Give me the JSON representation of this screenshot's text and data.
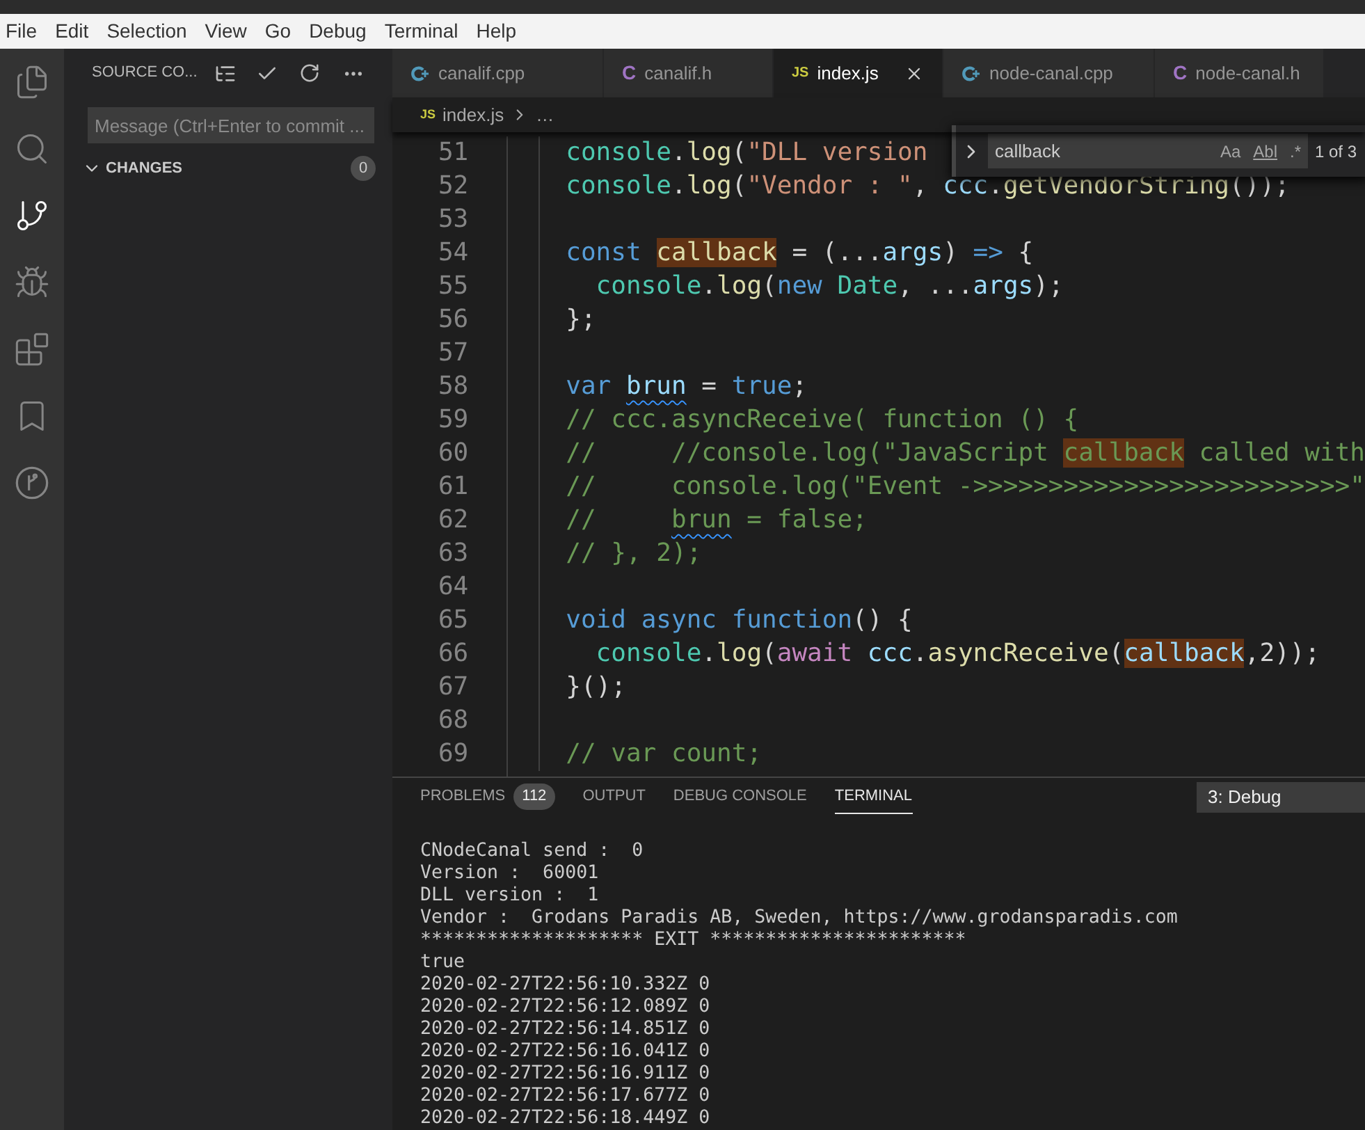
{
  "menu": [
    "File",
    "Edit",
    "Selection",
    "View",
    "Go",
    "Debug",
    "Terminal",
    "Help"
  ],
  "activity_bar": [
    {
      "kind": "files",
      "selected": false
    },
    {
      "kind": "search",
      "selected": false
    },
    {
      "kind": "source-control",
      "selected": true
    },
    {
      "kind": "debug",
      "selected": false
    },
    {
      "kind": "extensions",
      "selected": false
    },
    {
      "kind": "bookmarks",
      "selected": false
    },
    {
      "kind": "git-graph",
      "selected": false
    }
  ],
  "sidebar": {
    "title": "SOURCE CO...",
    "message_placeholder": "Message (Ctrl+Enter to commit ...",
    "section": {
      "label": "CHANGES",
      "expanded": true,
      "count": "0"
    }
  },
  "tabs": [
    {
      "label": "canalif.cpp",
      "kind": "cpp",
      "selected": false
    },
    {
      "label": "canalif.h",
      "kind": "c",
      "icon": "C",
      "selected": false
    },
    {
      "label": "index.js",
      "kind": "js",
      "icon": "JS",
      "selected": true
    },
    {
      "label": "node-canal.cpp",
      "kind": "cpp",
      "selected": false
    },
    {
      "label": "node-canal.h",
      "kind": "c",
      "icon": "C",
      "selected": false
    }
  ],
  "breadcrumb": {
    "icon": "JS",
    "file": "index.js",
    "rest": "…"
  },
  "find_widget": {
    "value": "callback",
    "options": [
      "Aa",
      "Abl",
      ".*"
    ],
    "result": "1 of 3"
  },
  "code": [
    {
      "number": "51",
      "tokens": [
        {
          "text": "console",
          "kind": "type"
        },
        {
          "text": ".",
          "kind": "plain"
        },
        {
          "text": "log",
          "kind": "func"
        },
        {
          "text": "(",
          "kind": "plain"
        },
        {
          "text": "\"DLL version ",
          "kind": "string"
        }
      ]
    },
    {
      "number": "52",
      "tokens": [
        {
          "text": "console",
          "kind": "type"
        },
        {
          "text": ".",
          "kind": "plain"
        },
        {
          "text": "log",
          "kind": "func"
        },
        {
          "text": "(",
          "kind": "plain"
        },
        {
          "text": "\"Vendor : \"",
          "kind": "string"
        },
        {
          "text": ", ",
          "kind": "plain"
        },
        {
          "text": "ccc",
          "kind": "var"
        },
        {
          "text": ".",
          "kind": "plain"
        },
        {
          "text": "getVendorString",
          "kind": "func"
        },
        {
          "text": "());",
          "kind": "plain"
        }
      ]
    },
    {
      "number": "53"
    },
    {
      "number": "54",
      "tokens": [
        {
          "text": "const ",
          "kind": "keyword"
        },
        {
          "text": "callback",
          "kind": "match-func"
        },
        {
          "text": " = (...",
          "kind": "plain"
        },
        {
          "text": "args",
          "kind": "var"
        },
        {
          "text": ") ",
          "kind": "plain"
        },
        {
          "text": "=>",
          "kind": "keyword"
        },
        {
          "text": " {",
          "kind": "plain"
        }
      ]
    },
    {
      "number": "55",
      "tokens": [
        {
          "text": "  console",
          "kind": "type"
        },
        {
          "text": ".",
          "kind": "plain"
        },
        {
          "text": "log",
          "kind": "func"
        },
        {
          "text": "(",
          "kind": "plain"
        },
        {
          "text": "new ",
          "kind": "keyword"
        },
        {
          "text": "Date",
          "kind": "type"
        },
        {
          "text": ", ...",
          "kind": "plain"
        },
        {
          "text": "args",
          "kind": "var"
        },
        {
          "text": ");",
          "kind": "plain"
        }
      ]
    },
    {
      "number": "56",
      "tokens": [
        {
          "text": "};",
          "kind": "plain"
        }
      ]
    },
    {
      "number": "57"
    },
    {
      "number": "58",
      "tokens": [
        {
          "text": "var ",
          "kind": "keyword"
        },
        {
          "text": "brun",
          "kind": "squiggle-var"
        },
        {
          "text": " = ",
          "kind": "plain"
        },
        {
          "text": "true",
          "kind": "keyword"
        },
        {
          "text": ";",
          "kind": "plain"
        }
      ]
    },
    {
      "number": "59",
      "tokens": [
        {
          "text": "// ccc.asyncReceive( function () {",
          "kind": "comment"
        }
      ]
    },
    {
      "number": "60",
      "tokens": [
        {
          "text": "//     //console.log(\"JavaScript ",
          "kind": "comment"
        },
        {
          "text": "callback",
          "kind": "match-comment"
        },
        {
          "text": " called with",
          "kind": "comment"
        }
      ]
    },
    {
      "number": "61",
      "tokens": [
        {
          "text": "//     console.log(\"Event ->>>>>>>>>>>>>>>>>>>>>>>>>\"",
          "kind": "comment"
        }
      ]
    },
    {
      "number": "62",
      "tokens": [
        {
          "text": "//     ",
          "kind": "comment"
        },
        {
          "text": "brun",
          "kind": "squiggle-comment"
        },
        {
          "text": " = false;",
          "kind": "comment"
        }
      ]
    },
    {
      "number": "63",
      "tokens": [
        {
          "text": "// }, 2);",
          "kind": "comment"
        }
      ]
    },
    {
      "number": "64"
    },
    {
      "number": "65",
      "tokens": [
        {
          "text": "void ",
          "kind": "keyword"
        },
        {
          "text": "async ",
          "kind": "keyword"
        },
        {
          "text": "function",
          "kind": "keyword"
        },
        {
          "text": "() {",
          "kind": "plain"
        }
      ]
    },
    {
      "number": "66",
      "tokens": [
        {
          "text": "  console",
          "kind": "type"
        },
        {
          "text": ".",
          "kind": "plain"
        },
        {
          "text": "log",
          "kind": "func"
        },
        {
          "text": "(",
          "kind": "plain"
        },
        {
          "text": "await ",
          "kind": "control"
        },
        {
          "text": "ccc",
          "kind": "var"
        },
        {
          "text": ".",
          "kind": "plain"
        },
        {
          "text": "asyncReceive",
          "kind": "func"
        },
        {
          "text": "(",
          "kind": "plain"
        },
        {
          "text": "callback",
          "kind": "match-var"
        },
        {
          "text": ",2));",
          "kind": "plain"
        }
      ]
    },
    {
      "number": "67",
      "tokens": [
        {
          "text": "}();",
          "kind": "plain"
        }
      ]
    },
    {
      "number": "68"
    },
    {
      "number": "69",
      "tokens": [
        {
          "text": "// var count;",
          "kind": "comment"
        }
      ]
    }
  ],
  "panel": {
    "tabs": [
      {
        "label": "PROBLEMS",
        "badge": "112",
        "selected": false
      },
      {
        "label": "OUTPUT",
        "selected": false
      },
      {
        "label": "DEBUG CONSOLE",
        "selected": false
      },
      {
        "label": "TERMINAL",
        "selected": true
      }
    ],
    "terminal_select": "3: Debug",
    "terminal_lines": [
      "CNodeCanal send :  0",
      "Version :  60001",
      "DLL version :  1",
      "Vendor :  Grodans Paradis AB, Sweden, https://www.grodansparadis.com",
      "******************** EXIT ***********************",
      "true",
      "2020-02-27T22:56:10.332Z 0",
      "2020-02-27T22:56:12.089Z 0",
      "2020-02-27T22:56:14.851Z 0",
      "2020-02-27T22:56:16.041Z 0",
      "2020-02-27T22:56:16.911Z 0",
      "2020-02-27T22:56:17.677Z 0",
      "2020-02-27T22:56:18.449Z 0"
    ]
  }
}
